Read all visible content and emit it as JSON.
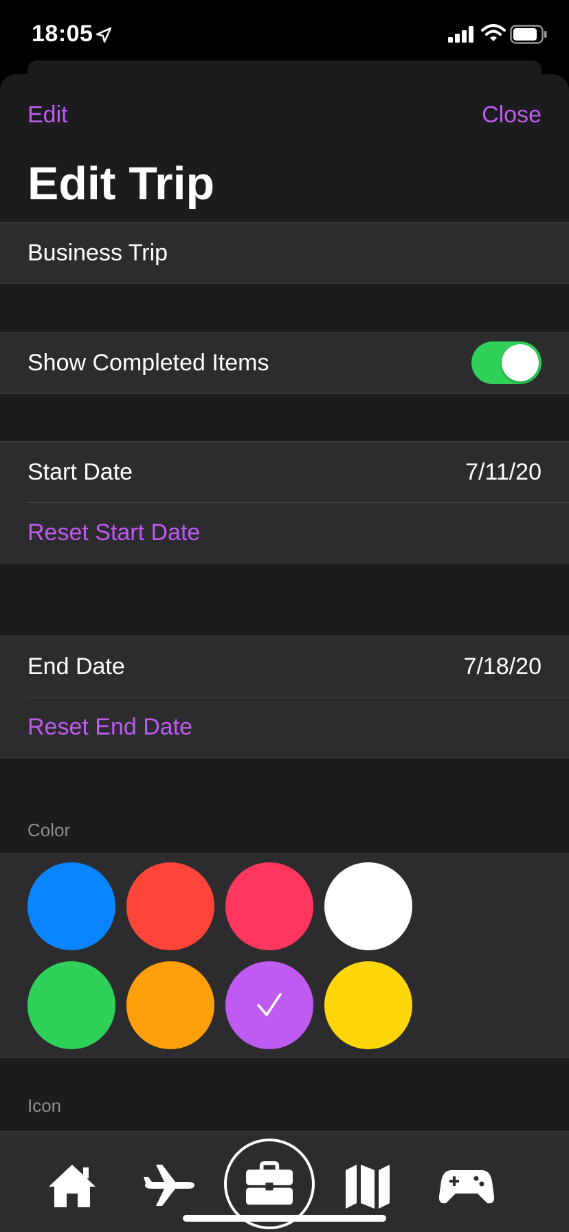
{
  "status_bar": {
    "time": "18:05"
  },
  "nav": {
    "edit_label": "Edit",
    "close_label": "Close",
    "title": "Edit Trip"
  },
  "trip_name": "Business Trip",
  "show_completed": {
    "label": "Show Completed Items",
    "enabled": true
  },
  "start_date": {
    "label": "Start Date",
    "value": "7/11/20",
    "reset_label": "Reset Start Date"
  },
  "end_date": {
    "label": "End Date",
    "value": "7/18/20",
    "reset_label": "Reset End Date"
  },
  "color_section": {
    "label": "Color",
    "swatches": [
      {
        "color": "#0a84ff"
      },
      {
        "color": "#ff453a"
      },
      {
        "color": "#ff375f"
      },
      {
        "color": "#ffffff"
      },
      {
        "color": "#30d158"
      },
      {
        "color": "#ff9f0a"
      },
      {
        "color": "#bf5af2",
        "selected": true
      },
      {
        "color": "#ffd60a"
      }
    ]
  },
  "icon_section": {
    "label": "Icon"
  },
  "tab_bar": {
    "tabs": [
      {
        "icon": "home-icon"
      },
      {
        "icon": "airplane-icon"
      },
      {
        "icon": "briefcase-icon",
        "selected": true
      },
      {
        "icon": "map-icon"
      },
      {
        "icon": "gamepad-icon"
      }
    ]
  },
  "colors": {
    "accent": "#bf5af2",
    "toggle_on": "#30d158"
  }
}
